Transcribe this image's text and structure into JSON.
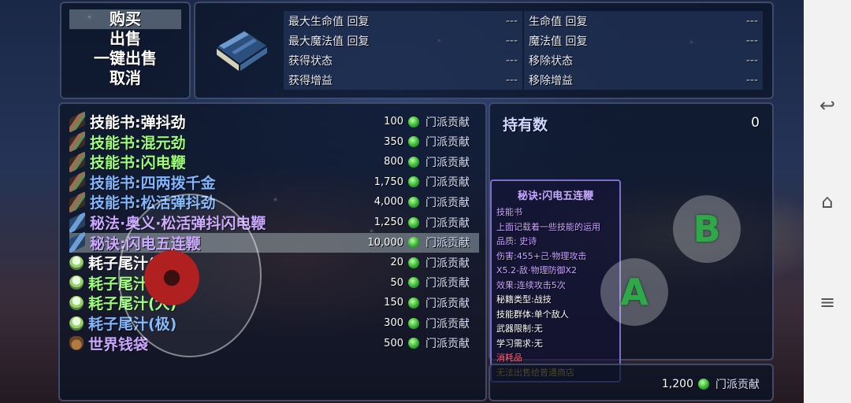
{
  "menu": {
    "items": [
      "购买",
      "出售",
      "一键出售",
      "取消"
    ],
    "selected_index": 0
  },
  "stats": {
    "rows": [
      [
        {
          "label": "最大生命值 回复",
          "value": "---"
        },
        {
          "label": "生命值 回复",
          "value": "---"
        }
      ],
      [
        {
          "label": "最大魔法值 回复",
          "value": "---"
        },
        {
          "label": "魔法值 回复",
          "value": "---"
        }
      ],
      [
        {
          "label": "获得状态",
          "value": "---"
        },
        {
          "label": "移除状态",
          "value": "---"
        }
      ],
      [
        {
          "label": "获得增益",
          "value": "---"
        },
        {
          "label": "移除增益",
          "value": "---"
        }
      ]
    ]
  },
  "currency_name": "门派贡献",
  "items": [
    {
      "name": "技能书:弹抖劲",
      "price": "100",
      "color": "#ffffff",
      "icon": "skill-book-icon"
    },
    {
      "name": "技能书:混元劲",
      "price": "350",
      "color": "#9cff7a",
      "icon": "skill-book-icon"
    },
    {
      "name": "技能书:闪电鞭",
      "price": "800",
      "color": "#9cff7a",
      "icon": "skill-book-icon"
    },
    {
      "name": "技能书:四两拨千金",
      "price": "1,750",
      "color": "#7fb6ff",
      "icon": "skill-book-icon"
    },
    {
      "name": "技能书:松活弹抖劲",
      "price": "4,000",
      "color": "#7fb6ff",
      "icon": "skill-book-icon"
    },
    {
      "name": "秘法·奥义·松活弹抖闪电鞭",
      "price": "1,250",
      "color": "#c9a6ff",
      "icon": "secret-book-icon"
    },
    {
      "name": "秘诀:闪电五连鞭",
      "price": "10,000",
      "color": "#c9a6ff",
      "icon": "secret-book-icon"
    },
    {
      "name": "耗子尾汁(小)",
      "price": "20",
      "color": "#ffffff",
      "icon": "potion-icon"
    },
    {
      "name": "耗子尾汁(中)",
      "price": "50",
      "color": "#9cff7a",
      "icon": "potion-icon"
    },
    {
      "name": "耗子尾汁(大)",
      "price": "150",
      "color": "#9cff7a",
      "icon": "potion-icon"
    },
    {
      "name": "耗子尾汁(极)",
      "price": "300",
      "color": "#7fb6ff",
      "icon": "potion-icon"
    },
    {
      "name": "世界钱袋",
      "price": "500",
      "color": "#c9a6ff",
      "icon": "money-bag-icon"
    }
  ],
  "selected_item_index": 6,
  "owned": {
    "label": "持有数",
    "count": "0"
  },
  "tooltip": {
    "title": "秘诀:闪电五连鞭",
    "lines": [
      {
        "text": "技能书",
        "color": "#c9a6ff"
      },
      {
        "text": "上面记载着一些技能的运用",
        "color": "#c9a6ff"
      },
      {
        "text": "品质: 史诗",
        "color": "#c9a6ff"
      },
      {
        "text": "伤害:455+己·物理攻击",
        "color": "#c9a6ff"
      },
      {
        "text": "X5.2-敌·物理防御X2",
        "color": "#c9a6ff"
      },
      {
        "text": "效果:连续攻击5次",
        "color": "#c9a6ff"
      },
      {
        "text": "秘籍类型:战技",
        "color": "#ffffff"
      },
      {
        "text": "技能群体:单个敌人",
        "color": "#ffffff"
      },
      {
        "text": "武器限制:无",
        "color": "#ffffff"
      },
      {
        "text": "学习需求:无",
        "color": "#ffffff"
      },
      {
        "text": "消耗品",
        "color": "#ff6b8a"
      },
      {
        "text": "无法出售给普通商店",
        "color": "#ffd23f"
      }
    ]
  },
  "wallet": {
    "amount": "1,200",
    "currency": "门派贡献"
  },
  "controls": {
    "a_label": "A",
    "b_label": "B"
  },
  "android_nav": {
    "back": "↩",
    "home": "⌂",
    "menu": "≡"
  }
}
